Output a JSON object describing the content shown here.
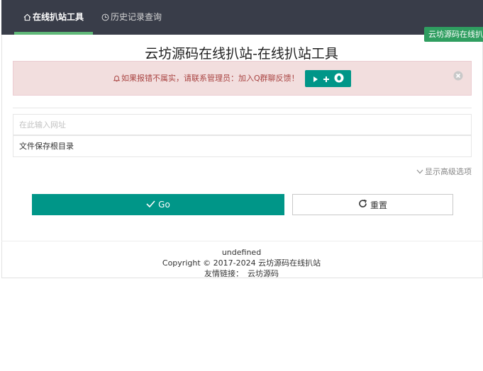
{
  "nav": {
    "tabs": [
      {
        "label": "在线扒站工具",
        "icon": "home-icon",
        "active": true
      },
      {
        "label": "历史记录查询",
        "icon": "clock-icon",
        "active": false
      }
    ]
  },
  "tooltip": {
    "text": "云坊源码在线扒站"
  },
  "page_title": "云坊源码在线扒站-在线扒站工具",
  "alert": {
    "text": "如果报错不属实，请联系管理员：加入Q群聊反馈！",
    "icon": "bell-icon",
    "qq_button_icons": [
      "play-icon",
      "plus-icon",
      "qq-icon"
    ],
    "close_icon": "close-circle-icon"
  },
  "form": {
    "url_placeholder": "在此输入网址",
    "url_value": "",
    "dir_label": "文件保存根目录",
    "advanced_toggle": "显示高级选项"
  },
  "buttons": {
    "go_label": "Go",
    "reset_label": "重置"
  },
  "footer": {
    "line1": "undefined",
    "copyright": "Copyright © 2017-2024 云坊源码在线扒站",
    "links_label": "友情链接：",
    "link_text": "云坊源码"
  },
  "colors": {
    "topbar": "#393d49",
    "accent": "#009688",
    "active_tab_bar": "#5fb878",
    "alert_bg": "#f2dede",
    "alert_text": "#a94442"
  }
}
